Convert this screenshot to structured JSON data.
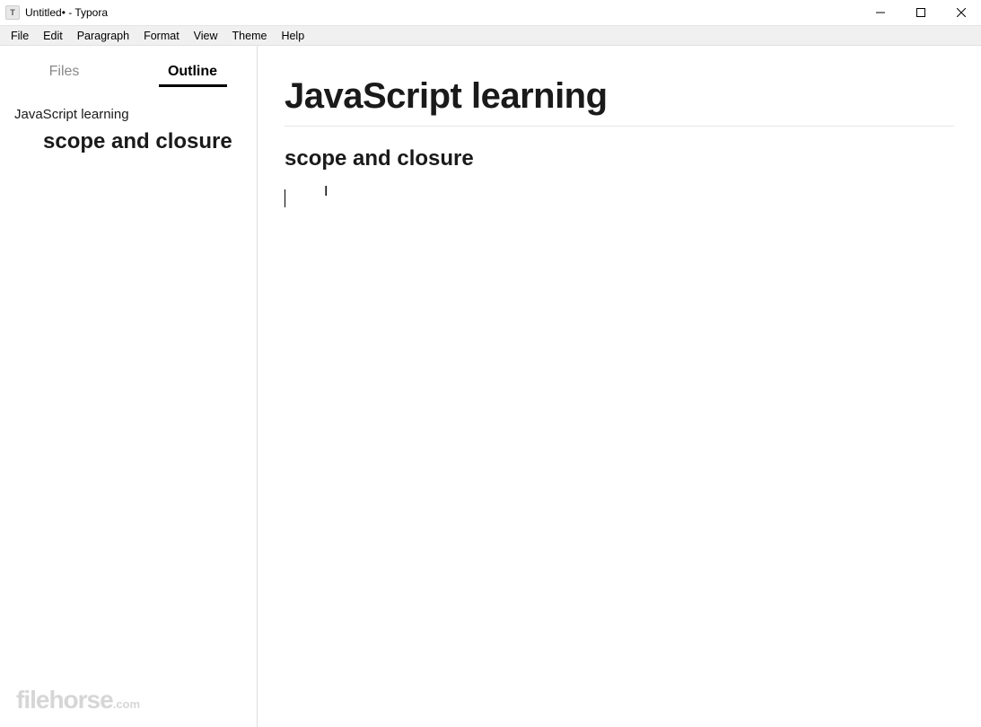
{
  "window": {
    "title": "Untitled• - Typora",
    "app_icon_letter": "T"
  },
  "menu": {
    "items": [
      "File",
      "Edit",
      "Paragraph",
      "Format",
      "View",
      "Theme",
      "Help"
    ]
  },
  "sidebar": {
    "tabs": {
      "files": "Files",
      "outline": "Outline"
    },
    "active_tab": "outline",
    "outline": [
      {
        "level": 1,
        "text": "JavaScript learning"
      },
      {
        "level": 2,
        "text": "scope and closure"
      }
    ]
  },
  "document": {
    "h1": "JavaScript learning",
    "h2": "scope and closure"
  },
  "watermark": {
    "brand": "filehorse",
    "suffix": ".com"
  }
}
